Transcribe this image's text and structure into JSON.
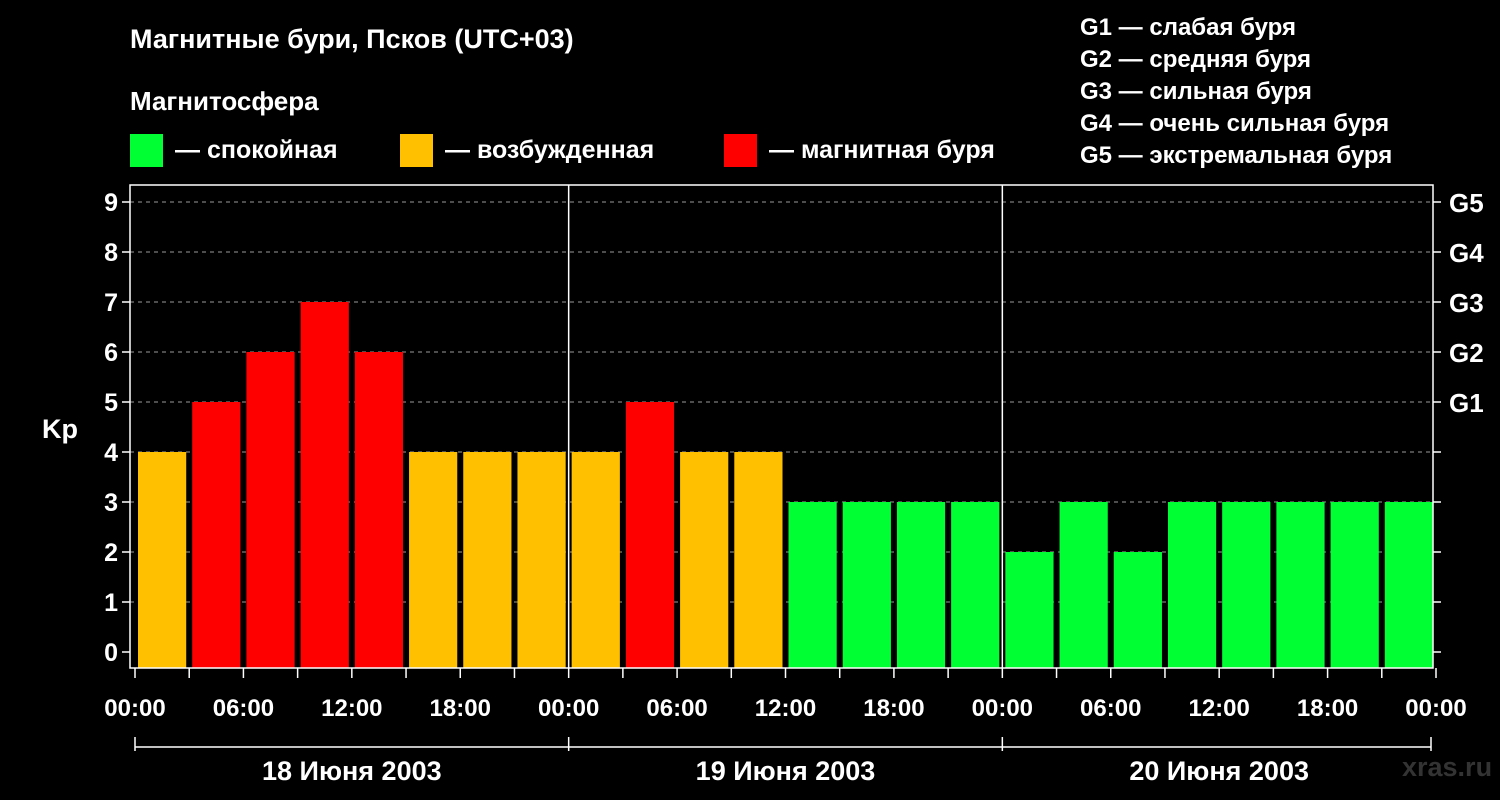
{
  "header": {
    "title": "Магнитные бури, Псков (UTC+03)",
    "subtitle": "Магнитосфера"
  },
  "legend": [
    {
      "label": "— спокойная",
      "color": "#00ff33"
    },
    {
      "label": "— возбужденная",
      "color": "#ffc000"
    },
    {
      "label": "— магнитная буря",
      "color": "#ff0000"
    }
  ],
  "g_legend": [
    "G1 — слабая буря",
    "G2 — средняя буря",
    "G3 — сильная буря",
    "G4 — очень сильная буря",
    "G5 — экстремальная буря"
  ],
  "watermark": "xras.ru",
  "chart_data": {
    "type": "bar",
    "ylabel": "Kp",
    "ylim": [
      0,
      9
    ],
    "yticks": [
      "0",
      "1",
      "2",
      "3",
      "4",
      "5",
      "6",
      "7",
      "8",
      "9"
    ],
    "right_ticks": [
      {
        "kp": 5,
        "label": "G1"
      },
      {
        "kp": 6,
        "label": "G2"
      },
      {
        "kp": 7,
        "label": "G3"
      },
      {
        "kp": 8,
        "label": "G4"
      },
      {
        "kp": 9,
        "label": "G5"
      }
    ],
    "grid": "horizontal dashed",
    "xtick_labels": [
      "00:00",
      "06:00",
      "12:00",
      "18:00",
      "00:00",
      "06:00",
      "12:00",
      "18:00",
      "00:00",
      "06:00",
      "12:00",
      "18:00",
      "00:00"
    ],
    "days": [
      "18 Июня 2003",
      "19 Июня 2003",
      "20 Июня 2003"
    ],
    "values": [
      4,
      5,
      6,
      7,
      6,
      4,
      4,
      4,
      4,
      5,
      4,
      4,
      3,
      3,
      3,
      3,
      2,
      3,
      2,
      3,
      3,
      3,
      3,
      3
    ],
    "colors": {
      "quiet": "#00ff33",
      "active": "#ffc000",
      "storm": "#ff0000"
    }
  }
}
